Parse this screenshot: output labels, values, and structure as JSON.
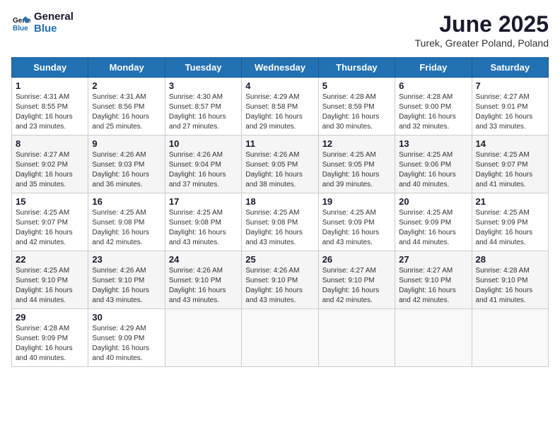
{
  "logo": {
    "line1": "General",
    "line2": "Blue"
  },
  "title": "June 2025",
  "subtitle": "Turek, Greater Poland, Poland",
  "weekdays": [
    "Sunday",
    "Monday",
    "Tuesday",
    "Wednesday",
    "Thursday",
    "Friday",
    "Saturday"
  ],
  "weeks": [
    [
      {
        "day": "1",
        "sunrise": "Sunrise: 4:31 AM",
        "sunset": "Sunset: 8:55 PM",
        "daylight": "Daylight: 16 hours and 23 minutes."
      },
      {
        "day": "2",
        "sunrise": "Sunrise: 4:31 AM",
        "sunset": "Sunset: 8:56 PM",
        "daylight": "Daylight: 16 hours and 25 minutes."
      },
      {
        "day": "3",
        "sunrise": "Sunrise: 4:30 AM",
        "sunset": "Sunset: 8:57 PM",
        "daylight": "Daylight: 16 hours and 27 minutes."
      },
      {
        "day": "4",
        "sunrise": "Sunrise: 4:29 AM",
        "sunset": "Sunset: 8:58 PM",
        "daylight": "Daylight: 16 hours and 29 minutes."
      },
      {
        "day": "5",
        "sunrise": "Sunrise: 4:28 AM",
        "sunset": "Sunset: 8:59 PM",
        "daylight": "Daylight: 16 hours and 30 minutes."
      },
      {
        "day": "6",
        "sunrise": "Sunrise: 4:28 AM",
        "sunset": "Sunset: 9:00 PM",
        "daylight": "Daylight: 16 hours and 32 minutes."
      },
      {
        "day": "7",
        "sunrise": "Sunrise: 4:27 AM",
        "sunset": "Sunset: 9:01 PM",
        "daylight": "Daylight: 16 hours and 33 minutes."
      }
    ],
    [
      {
        "day": "8",
        "sunrise": "Sunrise: 4:27 AM",
        "sunset": "Sunset: 9:02 PM",
        "daylight": "Daylight: 16 hours and 35 minutes."
      },
      {
        "day": "9",
        "sunrise": "Sunrise: 4:26 AM",
        "sunset": "Sunset: 9:03 PM",
        "daylight": "Daylight: 16 hours and 36 minutes."
      },
      {
        "day": "10",
        "sunrise": "Sunrise: 4:26 AM",
        "sunset": "Sunset: 9:04 PM",
        "daylight": "Daylight: 16 hours and 37 minutes."
      },
      {
        "day": "11",
        "sunrise": "Sunrise: 4:26 AM",
        "sunset": "Sunset: 9:05 PM",
        "daylight": "Daylight: 16 hours and 38 minutes."
      },
      {
        "day": "12",
        "sunrise": "Sunrise: 4:25 AM",
        "sunset": "Sunset: 9:05 PM",
        "daylight": "Daylight: 16 hours and 39 minutes."
      },
      {
        "day": "13",
        "sunrise": "Sunrise: 4:25 AM",
        "sunset": "Sunset: 9:06 PM",
        "daylight": "Daylight: 16 hours and 40 minutes."
      },
      {
        "day": "14",
        "sunrise": "Sunrise: 4:25 AM",
        "sunset": "Sunset: 9:07 PM",
        "daylight": "Daylight: 16 hours and 41 minutes."
      }
    ],
    [
      {
        "day": "15",
        "sunrise": "Sunrise: 4:25 AM",
        "sunset": "Sunset: 9:07 PM",
        "daylight": "Daylight: 16 hours and 42 minutes."
      },
      {
        "day": "16",
        "sunrise": "Sunrise: 4:25 AM",
        "sunset": "Sunset: 9:08 PM",
        "daylight": "Daylight: 16 hours and 42 minutes."
      },
      {
        "day": "17",
        "sunrise": "Sunrise: 4:25 AM",
        "sunset": "Sunset: 9:08 PM",
        "daylight": "Daylight: 16 hours and 43 minutes."
      },
      {
        "day": "18",
        "sunrise": "Sunrise: 4:25 AM",
        "sunset": "Sunset: 9:08 PM",
        "daylight": "Daylight: 16 hours and 43 minutes."
      },
      {
        "day": "19",
        "sunrise": "Sunrise: 4:25 AM",
        "sunset": "Sunset: 9:09 PM",
        "daylight": "Daylight: 16 hours and 43 minutes."
      },
      {
        "day": "20",
        "sunrise": "Sunrise: 4:25 AM",
        "sunset": "Sunset: 9:09 PM",
        "daylight": "Daylight: 16 hours and 44 minutes."
      },
      {
        "day": "21",
        "sunrise": "Sunrise: 4:25 AM",
        "sunset": "Sunset: 9:09 PM",
        "daylight": "Daylight: 16 hours and 44 minutes."
      }
    ],
    [
      {
        "day": "22",
        "sunrise": "Sunrise: 4:25 AM",
        "sunset": "Sunset: 9:10 PM",
        "daylight": "Daylight: 16 hours and 44 minutes."
      },
      {
        "day": "23",
        "sunrise": "Sunrise: 4:26 AM",
        "sunset": "Sunset: 9:10 PM",
        "daylight": "Daylight: 16 hours and 43 minutes."
      },
      {
        "day": "24",
        "sunrise": "Sunrise: 4:26 AM",
        "sunset": "Sunset: 9:10 PM",
        "daylight": "Daylight: 16 hours and 43 minutes."
      },
      {
        "day": "25",
        "sunrise": "Sunrise: 4:26 AM",
        "sunset": "Sunset: 9:10 PM",
        "daylight": "Daylight: 16 hours and 43 minutes."
      },
      {
        "day": "26",
        "sunrise": "Sunrise: 4:27 AM",
        "sunset": "Sunset: 9:10 PM",
        "daylight": "Daylight: 16 hours and 42 minutes."
      },
      {
        "day": "27",
        "sunrise": "Sunrise: 4:27 AM",
        "sunset": "Sunset: 9:10 PM",
        "daylight": "Daylight: 16 hours and 42 minutes."
      },
      {
        "day": "28",
        "sunrise": "Sunrise: 4:28 AM",
        "sunset": "Sunset: 9:10 PM",
        "daylight": "Daylight: 16 hours and 41 minutes."
      }
    ],
    [
      {
        "day": "29",
        "sunrise": "Sunrise: 4:28 AM",
        "sunset": "Sunset: 9:09 PM",
        "daylight": "Daylight: 16 hours and 40 minutes."
      },
      {
        "day": "30",
        "sunrise": "Sunrise: 4:29 AM",
        "sunset": "Sunset: 9:09 PM",
        "daylight": "Daylight: 16 hours and 40 minutes."
      },
      null,
      null,
      null,
      null,
      null
    ]
  ]
}
